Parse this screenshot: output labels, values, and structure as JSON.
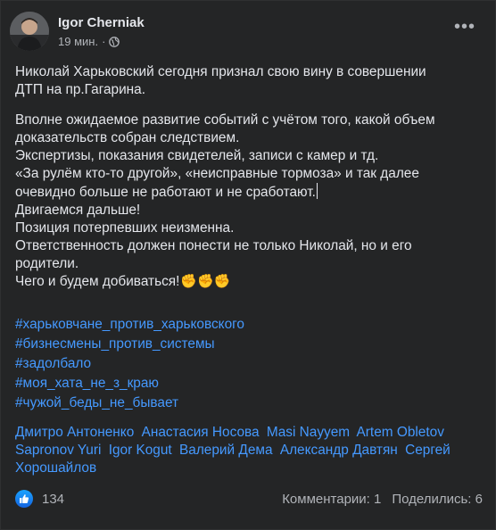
{
  "post": {
    "author": "Igor Cherniak",
    "time": "19 мин.",
    "separator": "·",
    "paragraphs": [
      [
        "Николай Харьковский сегодня признал свою вину в совершении",
        "ДТП на пр.Гагарина."
      ],
      [
        "Вполне ожидаемое развитие событий с учётом того, какой объем",
        "доказательств собран следствием.",
        "Экспертизы, показания свидетелей, записи с камер и тд.",
        "«За рулём кто-то другой», «неисправные тормоза» и так далее",
        "очевидно больше не работают и не сработают.",
        "Двигаемся дальше!",
        "Позиция потерпевших неизменна.",
        "Ответственность должен понести не только Николай, но и его",
        "родители.",
        "Чего и будем добиваться!"
      ]
    ],
    "emoji": "✊✊✊",
    "hashtags": [
      "#харьковчане_против_харьковского",
      "#бизнесмены_против_системы",
      "#задолбало",
      "#моя_хата_не_з_краю",
      "#чужой_беды_не_бывает"
    ],
    "tagged_people": [
      "Дмитро Антоненко",
      "Анастасия Носова",
      "Masi Nayyem",
      "Artem Obletov",
      "Sapronov Yuri",
      "Igor Kogut",
      "Валерий Дема",
      "Александр Давтян",
      "Сергей Хорошайлов"
    ]
  },
  "stats": {
    "likes": "134",
    "comments": "Комментарии: 1",
    "shares": "Поделились: 6"
  },
  "icons": {
    "privacy": "globe-icon",
    "menu": "more-options-icon",
    "reaction": "like-icon"
  },
  "colors": {
    "background": "#242526",
    "text": "#e4e6eb",
    "secondary": "#b0b3b8",
    "link": "#4599ff"
  }
}
